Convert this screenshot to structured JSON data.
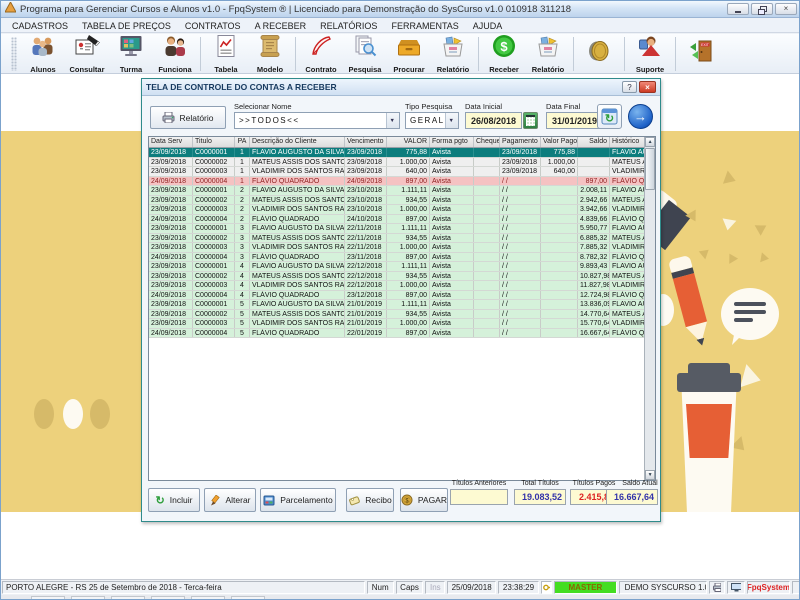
{
  "window": {
    "title": "Programa para Gerenciar Cursos e Alunos v1.0 - FpqSystem ® | Licenciado para  Demonstração do SysCurso v1.0 010918 311218"
  },
  "menu": {
    "items": [
      "CADASTROS",
      "TABELA DE PREÇOS",
      "CONTRATOS",
      "A RECEBER",
      "RELATÓRIOS",
      "FERRAMENTAS",
      "AJUDA"
    ]
  },
  "toolbar": {
    "buttons": [
      {
        "label": "Alunos",
        "icon": "students-icon"
      },
      {
        "label": "Consultar",
        "icon": "consult-card-icon"
      },
      {
        "label": "Turma",
        "icon": "class-monitor-icon"
      },
      {
        "label": "Funciona",
        "icon": "employees-icon"
      },
      {
        "label": "Tabela",
        "icon": "price-table-icon"
      },
      {
        "label": "Modelo",
        "icon": "template-scroll-icon"
      },
      {
        "label": "Contrato",
        "icon": "contract-pen-icon"
      },
      {
        "label": "Pesquisa",
        "icon": "search-docs-icon"
      },
      {
        "label": "Procurar",
        "icon": "find-drawer-icon"
      },
      {
        "label": "Relatório",
        "icon": "report-box-icon"
      },
      {
        "label": "Receber",
        "icon": "receive-dollar-icon"
      },
      {
        "label": "Relatório",
        "icon": "report-box-icon"
      },
      {
        "label": "",
        "icon": "coin-icon"
      },
      {
        "label": "Suporte",
        "icon": "support-person-icon"
      },
      {
        "label": "",
        "icon": "exit-door-icon"
      }
    ]
  },
  "dialog": {
    "title": "TELA DE CONTROLE DO CONTAS A RECEBER",
    "help_button": "?",
    "close_button": "x",
    "report_button": "Relatório",
    "select_name": {
      "label": "Selecionar Nome",
      "value": ">>TODOS<<"
    },
    "search_type": {
      "label": "Tipo  Pesquisa",
      "value": "GERAL"
    },
    "date_start": {
      "label": "Data Inicial",
      "value": "26/08/2018"
    },
    "date_end": {
      "label": "Data Final",
      "value": "31/01/2019"
    },
    "grid": {
      "columns": [
        "Data Serv",
        "Titulo",
        "PA",
        "Descrição do Cliente",
        "Vencimento",
        "VALOR",
        "Forma pgto",
        "Cheque",
        "Pagamento",
        "Valor Pago",
        "Saldo",
        "Histórico"
      ],
      "rows": [
        {
          "state": "selected",
          "cells": [
            "23/09/2018",
            "C0000001",
            "1",
            "FLAVIO AUGUSTO DA SILVA",
            "23/09/2018",
            "775,88",
            "Avista",
            "",
            "23/09/2018",
            "775,88",
            "",
            "FLAVIO AUGU"
          ]
        },
        {
          "state": "paid",
          "cells": [
            "23/09/2018",
            "C0000002",
            "1",
            "MATEUS ASSIS DOS SANTOS",
            "23/09/2018",
            "1.000,00",
            "Avista",
            "",
            "23/09/2018",
            "1.000,00",
            "",
            "MATEUS ASSI"
          ]
        },
        {
          "state": "paid",
          "cells": [
            "23/09/2018",
            "C0000003",
            "1",
            "VLADIMIR DOS SANTOS RAU",
            "23/09/2018",
            "640,00",
            "Avista",
            "",
            "23/09/2018",
            "640,00",
            "",
            "VLADIMIR DO"
          ]
        },
        {
          "state": "overdue",
          "cells": [
            "24/09/2018",
            "C0000004",
            "1",
            "FLÁVIO QUADRADO",
            "24/09/2018",
            "897,00",
            "Avista",
            "",
            "/ /",
            "",
            "897,00",
            "FLÁVIO QUAD"
          ]
        },
        {
          "state": "open",
          "cells": [
            "23/09/2018",
            "C0000001",
            "2",
            "FLAVIO AUGUSTO DA SILVA",
            "23/10/2018",
            "1.111,11",
            "Avista",
            "",
            "/ /",
            "",
            "2.008,11",
            "FLAVIO AUGU"
          ]
        },
        {
          "state": "open",
          "cells": [
            "23/09/2018",
            "C0000002",
            "2",
            "MATEUS ASSIS DOS SANTOS",
            "23/10/2018",
            "934,55",
            "Avista",
            "",
            "/ /",
            "",
            "2.942,66",
            "MATEUS ASSI"
          ]
        },
        {
          "state": "open",
          "cells": [
            "23/09/2018",
            "C0000003",
            "2",
            "VLADIMIR DOS SANTOS RAU",
            "23/10/2018",
            "1.000,00",
            "Avista",
            "",
            "/ /",
            "",
            "3.942,66",
            "VLADIMIR DO"
          ]
        },
        {
          "state": "open",
          "cells": [
            "24/09/2018",
            "C0000004",
            "2",
            "FLÁVIO QUADRADO",
            "24/10/2018",
            "897,00",
            "Avista",
            "",
            "/ /",
            "",
            "4.839,66",
            "FLÁVIO QUAD"
          ]
        },
        {
          "state": "open",
          "cells": [
            "23/09/2018",
            "C0000001",
            "3",
            "FLAVIO AUGUSTO DA SILVA",
            "22/11/2018",
            "1.111,11",
            "Avista",
            "",
            "/ /",
            "",
            "5.950,77",
            "FLAVIO AUGU"
          ]
        },
        {
          "state": "open",
          "cells": [
            "23/09/2018",
            "C0000002",
            "3",
            "MATEUS ASSIS DOS SANTOS",
            "22/11/2018",
            "934,55",
            "Avista",
            "",
            "/ /",
            "",
            "6.885,32",
            "MATEUS ASSI"
          ]
        },
        {
          "state": "open",
          "cells": [
            "23/09/2018",
            "C0000003",
            "3",
            "VLADIMIR DOS SANTOS RAU",
            "22/11/2018",
            "1.000,00",
            "Avista",
            "",
            "/ /",
            "",
            "7.885,32",
            "VLADIMIR DO"
          ]
        },
        {
          "state": "open",
          "cells": [
            "24/09/2018",
            "C0000004",
            "3",
            "FLÁVIO QUADRADO",
            "23/11/2018",
            "897,00",
            "Avista",
            "",
            "/ /",
            "",
            "8.782,32",
            "FLÁVIO QUAD"
          ]
        },
        {
          "state": "open",
          "cells": [
            "23/09/2018",
            "C0000001",
            "4",
            "FLAVIO AUGUSTO DA SILVA",
            "22/12/2018",
            "1.111,11",
            "Avista",
            "",
            "/ /",
            "",
            "9.893,43",
            "FLAVIO AUGU"
          ]
        },
        {
          "state": "open",
          "cells": [
            "23/09/2018",
            "C0000002",
            "4",
            "MATEUS ASSIS DOS SANTOS",
            "22/12/2018",
            "934,55",
            "Avista",
            "",
            "/ /",
            "",
            "10.827,98",
            "MATEUS ASSI"
          ]
        },
        {
          "state": "open",
          "cells": [
            "23/09/2018",
            "C0000003",
            "4",
            "VLADIMIR DOS SANTOS RAU",
            "22/12/2018",
            "1.000,00",
            "Avista",
            "",
            "/ /",
            "",
            "11.827,98",
            "VLADIMIR DO"
          ]
        },
        {
          "state": "open",
          "cells": [
            "24/09/2018",
            "C0000004",
            "4",
            "FLÁVIO QUADRADO",
            "23/12/2018",
            "897,00",
            "Avista",
            "",
            "/ /",
            "",
            "12.724,98",
            "FLÁVIO QUAD"
          ]
        },
        {
          "state": "open",
          "cells": [
            "23/09/2018",
            "C0000001",
            "5",
            "FLAVIO AUGUSTO DA SILVA",
            "21/01/2019",
            "1.111,11",
            "Avista",
            "",
            "/ /",
            "",
            "13.836,09",
            "FLAVIO AUGU"
          ]
        },
        {
          "state": "open",
          "cells": [
            "23/09/2018",
            "C0000002",
            "5",
            "MATEUS ASSIS DOS SANTOS",
            "21/01/2019",
            "934,55",
            "Avista",
            "",
            "/ /",
            "",
            "14.770,64",
            "MATEUS ASSI"
          ]
        },
        {
          "state": "open",
          "cells": [
            "23/09/2018",
            "C0000003",
            "5",
            "VLADIMIR DOS SANTOS RAU",
            "21/01/2019",
            "1.000,00",
            "Avista",
            "",
            "/ /",
            "",
            "15.770,64",
            "VLADIMIR DO"
          ]
        },
        {
          "state": "open",
          "cells": [
            "24/09/2018",
            "C0000004",
            "5",
            "FLÁVIO QUADRADO",
            "22/01/2019",
            "897,00",
            "Avista",
            "",
            "/ /",
            "",
            "16.667,64",
            "FLÁVIO QUAD"
          ]
        }
      ]
    },
    "footer": {
      "incluir": "Incluir",
      "alterar": "Alterar",
      "parcelamento": "Parcelamento",
      "recibo": "Recibo",
      "pagar": "PAGAR",
      "totals": {
        "anteriores": {
          "label": "Títulos Anteriores",
          "value": ""
        },
        "total": {
          "label": "Total Títulos",
          "value": "19.083,52"
        },
        "pagos": {
          "label": "Títulos Pagos",
          "value": "2.415,88"
        },
        "saldo": {
          "label": "Saldo Atual",
          "value": "16.667,64"
        }
      }
    }
  },
  "statusbar": {
    "location": "PORTO ALEGRE - RS 25 de Setembro de 2018 - Terca-feira",
    "num": "Num",
    "caps": "Caps",
    "ins": "Ins",
    "date": "25/09/2018",
    "time": "23:38:29",
    "master": "MASTER",
    "demo": "DEMO SYSCURSO 1.0",
    "brand": "FpqSystem"
  },
  "colors": {
    "wallpaper": "#edd17c",
    "accent_teal": "#0c7d7d",
    "row_open": "#d5f1da",
    "row_overdue": "#f5c2c2",
    "total_blue": "#3333aa",
    "total_red": "#dd2222",
    "master_green": "#44dd22"
  }
}
